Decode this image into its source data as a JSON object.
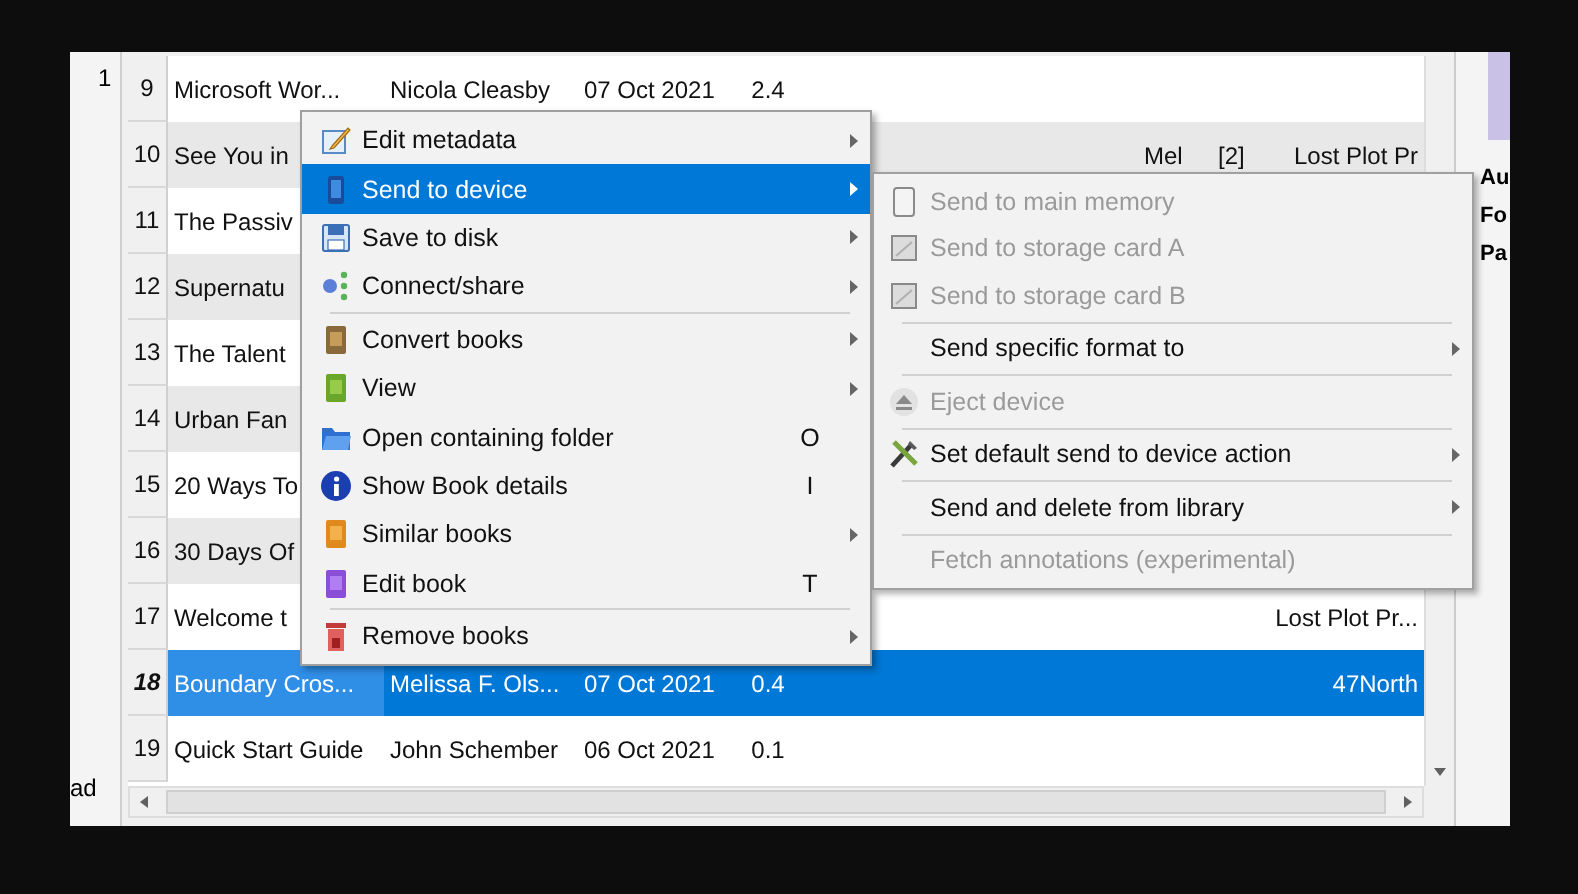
{
  "left_panel": {
    "top_text": "1",
    "bottom_text": "ad"
  },
  "table": {
    "rows": [
      {
        "number": "9",
        "selected": false,
        "column_1": "Microsoft Wor...",
        "column_2": "Nicola Cleasby",
        "column_3": "07 Oct 2021",
        "column_4": "2.4"
      },
      {
        "number": "10",
        "selected": false,
        "column_1": "See You in",
        "column_6": "Mel",
        "column_7": "[2]",
        "column_8": "Lost Plot Pr"
      },
      {
        "number": "11",
        "selected": false,
        "column_1": "The Passiv"
      },
      {
        "number": "12",
        "selected": false,
        "column_1": "Supernatu"
      },
      {
        "number": "13",
        "selected": false,
        "column_1": "The Talent"
      },
      {
        "number": "14",
        "selected": false,
        "column_1": "Urban Fan"
      },
      {
        "number": "15",
        "selected": false,
        "column_1": "20 Ways To"
      },
      {
        "number": "16",
        "selected": false,
        "column_1": "30 Days Of"
      },
      {
        "number": "17",
        "selected": false,
        "column_1": "Welcome t",
        "column_8": "Lost Plot Pr..."
      },
      {
        "number": "18",
        "selected": true,
        "column_1": "Boundary Cros...",
        "column_2": "Melissa F. Ols...",
        "column_3": "07 Oct 2021",
        "column_4": "0.4",
        "column_8": "47North"
      },
      {
        "number": "19",
        "selected": false,
        "column_1": "Quick Start Guide",
        "column_2": "John Schember",
        "column_3": "06 Oct 2021",
        "column_4": "0.1"
      }
    ]
  },
  "right_panel": {
    "texts": [
      "Au",
      "Fo",
      "Pa"
    ]
  },
  "context_menu": {
    "items": [
      {
        "kind": "item",
        "label": "Edit metadata",
        "submenu": true,
        "selected": false
      },
      {
        "kind": "item",
        "label": "Send to device",
        "submenu": true,
        "selected": true
      },
      {
        "kind": "item",
        "label": "Save to disk",
        "submenu": true,
        "selected": false
      },
      {
        "kind": "item",
        "label": "Connect/share",
        "submenu": true,
        "selected": false
      },
      {
        "kind": "separator"
      },
      {
        "kind": "item",
        "label": "Convert books",
        "submenu": true,
        "selected": false
      },
      {
        "kind": "item",
        "label": "View",
        "submenu": true,
        "selected": false
      },
      {
        "kind": "item",
        "label": "Open containing folder",
        "shortcut": "O",
        "submenu": false,
        "selected": false
      },
      {
        "kind": "item",
        "label": "Show Book details",
        "shortcut": "I",
        "submenu": false,
        "selected": false
      },
      {
        "kind": "item",
        "label": "Similar books",
        "submenu": true,
        "selected": false
      },
      {
        "kind": "item",
        "label": "Edit book",
        "shortcut": "T",
        "submenu": false,
        "selected": false
      },
      {
        "kind": "separator"
      },
      {
        "kind": "item",
        "label": "Remove books",
        "submenu": true,
        "selected": false
      }
    ]
  },
  "submenu": {
    "items": [
      {
        "kind": "item",
        "label": "Send to main memory",
        "submenu": false,
        "disabled": true
      },
      {
        "kind": "item",
        "label": "Send to storage card A",
        "submenu": false,
        "disabled": true
      },
      {
        "kind": "item",
        "label": "Send to storage card B",
        "submenu": false,
        "disabled": true
      },
      {
        "kind": "separator"
      },
      {
        "kind": "item",
        "label": "Send specific format to",
        "submenu": true,
        "disabled": false
      },
      {
        "kind": "separator"
      },
      {
        "kind": "item",
        "label": "Eject device",
        "submenu": false,
        "disabled": true
      },
      {
        "kind": "separator"
      },
      {
        "kind": "item",
        "label": "Set default send to device action",
        "submenu": true,
        "disabled": false
      },
      {
        "kind": "separator"
      },
      {
        "kind": "item",
        "label": "Send and delete from library",
        "submenu": true,
        "disabled": false
      },
      {
        "kind": "separator"
      },
      {
        "kind": "item",
        "label": "Fetch annotations (experimental)",
        "submenu": false,
        "disabled": true
      }
    ]
  }
}
